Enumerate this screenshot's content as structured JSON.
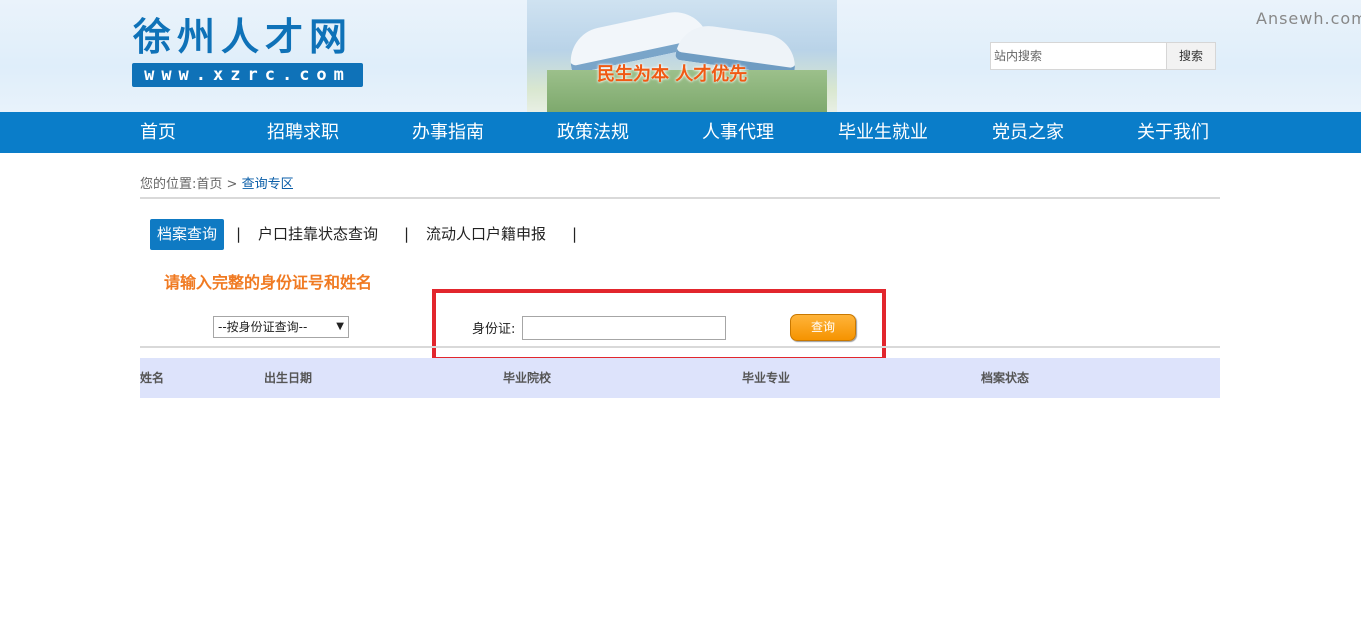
{
  "header": {
    "logo_title": "徐州人才网",
    "logo_url": "www.xzrc.com",
    "banner_slogan": "民生为本 人才优先",
    "watermark": "Ansewh.com",
    "search": {
      "placeholder": "站内搜索",
      "button_label": "搜索"
    }
  },
  "nav": {
    "items": [
      {
        "label": "首页"
      },
      {
        "label": "招聘求职"
      },
      {
        "label": "办事指南"
      },
      {
        "label": "政策法规"
      },
      {
        "label": "人事代理"
      },
      {
        "label": "毕业生就业"
      },
      {
        "label": "党员之家"
      },
      {
        "label": "关于我们"
      }
    ]
  },
  "breadcrumb": {
    "prefix": "您的位置:",
    "home": "首页",
    "separator": ">",
    "current": "查询专区"
  },
  "tabs": [
    {
      "label": "档案查询",
      "active": true
    },
    {
      "label": "户口挂靠状态查询",
      "active": false
    },
    {
      "label": "流动人口户籍申报",
      "active": false
    }
  ],
  "tab_separator": "|",
  "notice": "请输入完整的身份证号和姓名",
  "form": {
    "select_value": "--按身份证查询--",
    "id_label": "身份证:",
    "id_value": "",
    "query_button": "查询"
  },
  "table": {
    "headers": [
      "姓名",
      "出生日期",
      "毕业院校",
      "毕业专业",
      "档案状态"
    ]
  },
  "colors": {
    "brand_blue": "#0a7dc9",
    "notice_orange": "#f07a22",
    "button_orange": "#f59300",
    "highlight_red": "#e2262d",
    "table_header_bg": "#dde3fb"
  }
}
